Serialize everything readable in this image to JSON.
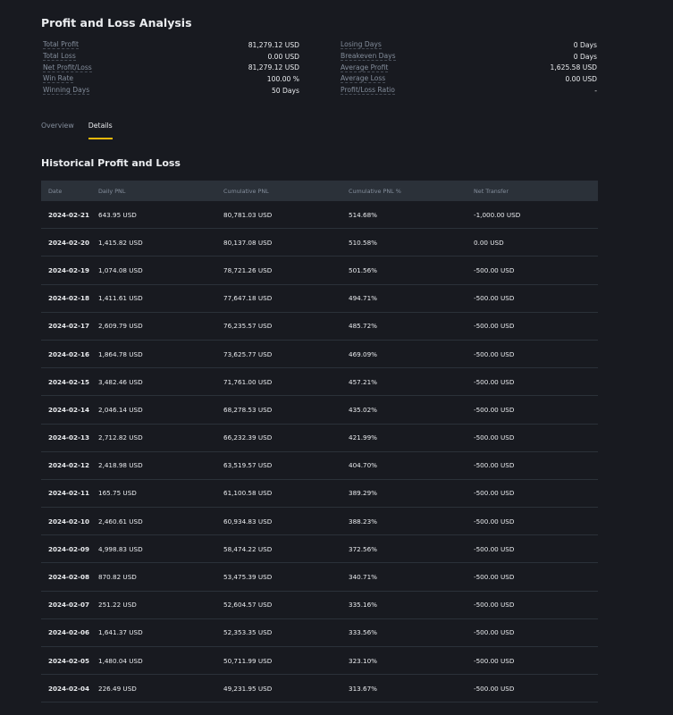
{
  "page_title": "Profit and Loss Analysis",
  "stats_left": [
    {
      "label": "Total Profit",
      "value": "81,279.12 USD"
    },
    {
      "label": "Total Loss",
      "value": "0.00 USD"
    },
    {
      "label": "Net Profit/Loss",
      "value": "81,279.12 USD"
    },
    {
      "label": "Win Rate",
      "value": "100.00 %"
    },
    {
      "label": "Winning Days",
      "value": "50 Days"
    }
  ],
  "stats_right": [
    {
      "label": "Losing Days",
      "value": "0 Days"
    },
    {
      "label": "Breakeven Days",
      "value": "0 Days"
    },
    {
      "label": "Average Profit",
      "value": "1,625.58 USD"
    },
    {
      "label": "Average Loss",
      "value": "0.00 USD"
    },
    {
      "label": "Profit/Loss Ratio",
      "value": "-"
    }
  ],
  "tabs": [
    {
      "label": "Overview",
      "active": false
    },
    {
      "label": "Details",
      "active": true
    }
  ],
  "accent_color": "#f0b90b",
  "section_title": "Historical Profit and Loss",
  "table": {
    "headers": [
      "Date",
      "Daily PNL",
      "Cumulative PNL",
      "Cumulative PNL %",
      "Net Transfer"
    ],
    "rows": [
      [
        "2024-02-21",
        "643.95 USD",
        "80,781.03 USD",
        "514.68%",
        "-1,000.00 USD"
      ],
      [
        "2024-02-20",
        "1,415.82 USD",
        "80,137.08 USD",
        "510.58%",
        "0.00 USD"
      ],
      [
        "2024-02-19",
        "1,074.08 USD",
        "78,721.26 USD",
        "501.56%",
        "-500.00 USD"
      ],
      [
        "2024-02-18",
        "1,411.61 USD",
        "77,647.18 USD",
        "494.71%",
        "-500.00 USD"
      ],
      [
        "2024-02-17",
        "2,609.79 USD",
        "76,235.57 USD",
        "485.72%",
        "-500.00 USD"
      ],
      [
        "2024-02-16",
        "1,864.78 USD",
        "73,625.77 USD",
        "469.09%",
        "-500.00 USD"
      ],
      [
        "2024-02-15",
        "3,482.46 USD",
        "71,761.00 USD",
        "457.21%",
        "-500.00 USD"
      ],
      [
        "2024-02-14",
        "2,046.14 USD",
        "68,278.53 USD",
        "435.02%",
        "-500.00 USD"
      ],
      [
        "2024-02-13",
        "2,712.82 USD",
        "66,232.39 USD",
        "421.99%",
        "-500.00 USD"
      ],
      [
        "2024-02-12",
        "2,418.98 USD",
        "63,519.57 USD",
        "404.70%",
        "-500.00 USD"
      ],
      [
        "2024-02-11",
        "165.75 USD",
        "61,100.58 USD",
        "389.29%",
        "-500.00 USD"
      ],
      [
        "2024-02-10",
        "2,460.61 USD",
        "60,934.83 USD",
        "388.23%",
        "-500.00 USD"
      ],
      [
        "2024-02-09",
        "4,998.83 USD",
        "58,474.22 USD",
        "372.56%",
        "-500.00 USD"
      ],
      [
        "2024-02-08",
        "870.82 USD",
        "53,475.39 USD",
        "340.71%",
        "-500.00 USD"
      ],
      [
        "2024-02-07",
        "251.22 USD",
        "52,604.57 USD",
        "335.16%",
        "-500.00 USD"
      ],
      [
        "2024-02-06",
        "1,641.37 USD",
        "52,353.35 USD",
        "333.56%",
        "-500.00 USD"
      ],
      [
        "2024-02-05",
        "1,480.04 USD",
        "50,711.99 USD",
        "323.10%",
        "-500.00 USD"
      ],
      [
        "2024-02-04",
        "226.49 USD",
        "49,231.95 USD",
        "313.67%",
        "-500.00 USD"
      ]
    ]
  }
}
